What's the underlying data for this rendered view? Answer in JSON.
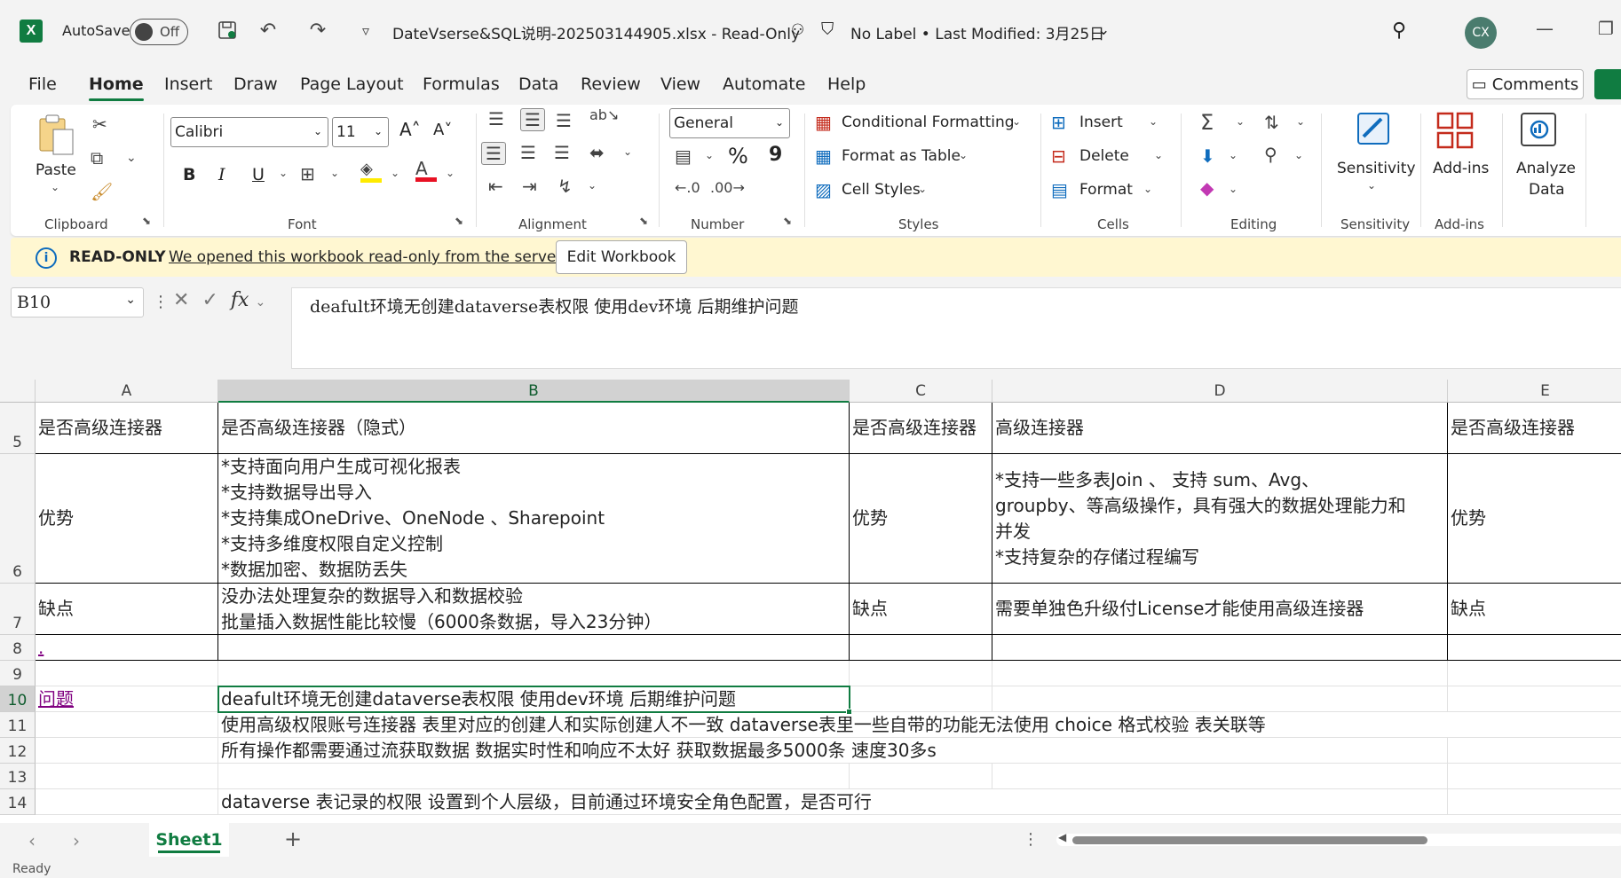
{
  "titlebar": {
    "app_logo": "X",
    "autosave_label": "AutoSave",
    "autosave_state": "Off",
    "document_title": "DateVserse&SQL说明-202503144905.xlsx  -  Read-Only",
    "label_status": "No Label  •  Last Modified: 3月25日",
    "user_initials": "CX",
    "icons": [
      "excel-icon",
      "save-icon",
      "undo-icon",
      "redo-icon",
      "customize-icon",
      "people-icon",
      "shield-icon",
      "search-icon",
      "minimize-icon",
      "restore-icon"
    ]
  },
  "tabs": [
    "File",
    "Home",
    "Insert",
    "Draw",
    "Page Layout",
    "Formulas",
    "Data",
    "Review",
    "View",
    "Automate",
    "Help"
  ],
  "active_tab": "Home",
  "comments_label": "Comments",
  "ribbon": {
    "clipboard": {
      "paste": "Paste",
      "group": "Clipboard"
    },
    "font": {
      "name": "Calibri",
      "size": "11",
      "group": "Font",
      "bold": "B",
      "italic": "I",
      "underline": "U"
    },
    "alignment": {
      "group": "Alignment"
    },
    "number": {
      "format": "General",
      "group": "Number",
      "percent": "%",
      "comma": "9"
    },
    "styles": {
      "conditional": "Conditional Formatting",
      "format_table": "Format as Table",
      "cell_styles": "Cell Styles",
      "group": "Styles"
    },
    "cells": {
      "insert": "Insert",
      "delete": "Delete",
      "format": "Format",
      "group": "Cells"
    },
    "editing": {
      "group": "Editing"
    },
    "sensitivity": {
      "label": "Sensitivity",
      "group": "Sensitivity"
    },
    "addins": {
      "label": "Add-ins",
      "group": "Add-ins"
    },
    "analyze": {
      "label1": "Analyze",
      "label2": "Data"
    }
  },
  "readonly_bar": {
    "title": "READ-ONLY",
    "message": "We opened this workbook read-only from the server.",
    "button": "Edit Workbook"
  },
  "formula_bar": {
    "name_box": "B10",
    "formula": "deafult环境无创建dataverse表权限  使用dev环境   后期维护问题"
  },
  "columns": [
    "A",
    "B",
    "C",
    "D",
    "E"
  ],
  "rows": [
    {
      "num": "5",
      "cells": [
        "是否高级连接器",
        "是否高级连接器（隐式）",
        "是否高级连接器",
        "高级连接器",
        "是否高级连接器"
      ]
    },
    {
      "num": "6",
      "cells": [
        "优势",
        "*支持面向用户生成可视化报表\n*支持数据导出导入\n*支持集成OneDrive、OneNode 、Sharepoint\n*支持多维度权限自定义控制\n*数据加密、数据防丢失",
        "优势",
        "*支持一些多表Join 、 支持 sum、Avg、\ngroupby、等高级操作，具有强大的数据处理能力和\n并发\n*支持复杂的存储过程编写",
        "优势"
      ]
    },
    {
      "num": "7",
      "cells": [
        "缺点",
        "没办法处理复杂的数据导入和数据校验\n批量插入数据性能比较慢（6000条数据，导入23分钟）",
        "缺点",
        "需要单独色升级付License才能使用高级连接器",
        "缺点"
      ]
    },
    {
      "num": "8",
      "cells": [
        ".",
        "",
        "",
        "",
        ""
      ]
    },
    {
      "num": "9",
      "cells": [
        "",
        "",
        "",
        "",
        ""
      ]
    },
    {
      "num": "10",
      "cells": [
        "问题",
        "deafult环境无创建dataverse表权限 使用dev环境  后期维护问题",
        "",
        "",
        ""
      ]
    },
    {
      "num": "11",
      "cells": [
        "",
        "使用高级权限账号连接器  表里对应的创建人和实际创建人不一致  dataverse表里一些自带的功能无法使用  choice  格式校验  表关联等",
        "",
        "",
        ""
      ]
    },
    {
      "num": "12",
      "cells": [
        "",
        "所有操作都需要通过流获取数据 数据实时性和响应不太好   获取数据最多5000条 速度30多s",
        "",
        "",
        ""
      ]
    },
    {
      "num": "13",
      "cells": [
        "",
        "",
        "",
        "",
        ""
      ]
    },
    {
      "num": "14",
      "cells": [
        "",
        "dataverse 表记录的权限  设置到个人层级，目前通过环境安全角色配置，是否可行",
        "",
        "",
        ""
      ]
    }
  ],
  "sheet_tab": "Sheet1",
  "status_left": "Ready",
  "colors": {
    "accent": "#107c41",
    "readonly_bg": "#fff7d1",
    "link": "#800080"
  }
}
